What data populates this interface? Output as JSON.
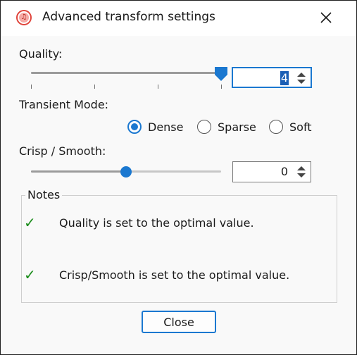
{
  "window": {
    "title": "Advanced transform settings",
    "app_icon": "music-note-icon",
    "close_icon": "close-icon"
  },
  "quality": {
    "label": "Quality:",
    "value": "4",
    "slider_fraction": 1.0,
    "value_selected": true
  },
  "transient_mode": {
    "label": "Transient Mode:",
    "options": [
      {
        "label": "Dense",
        "checked": true
      },
      {
        "label": "Sparse",
        "checked": false
      },
      {
        "label": "Soft",
        "checked": false
      }
    ]
  },
  "crisp_smooth": {
    "label": "Crisp / Smooth:",
    "value": "0",
    "slider_fraction": 0.5
  },
  "notes": {
    "title": "Notes",
    "items": [
      {
        "icon": "checkmark-icon",
        "text": "Quality is set to the optimal value."
      },
      {
        "icon": "checkmark-icon",
        "text": "Crisp/Smooth is set to the optimal value."
      }
    ]
  },
  "buttons": {
    "close_label": "Close"
  },
  "colors": {
    "accent": "#1b78d0",
    "check": "#1a8c1a",
    "app_icon": "#e0453c"
  }
}
